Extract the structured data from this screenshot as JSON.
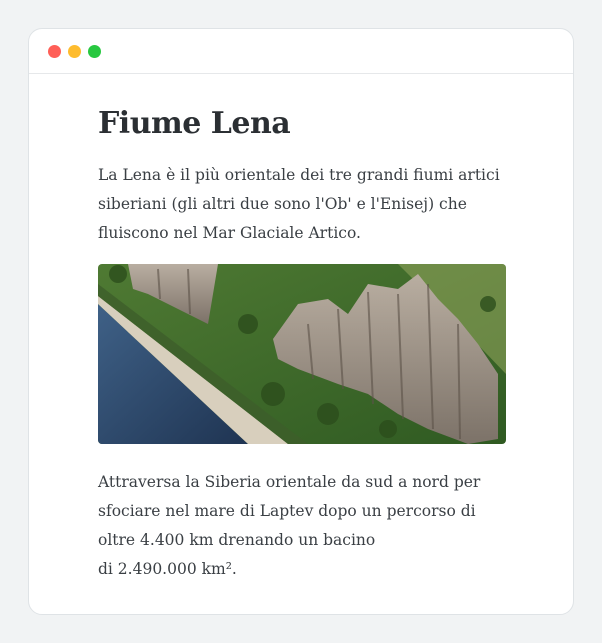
{
  "window": {
    "controls": [
      "close",
      "minimize",
      "maximize"
    ]
  },
  "article": {
    "title": "Fiume Lena",
    "intro": "La Lena è il più orientale dei tre grandi fiumi artici siberiani (gli altri due sono l'Ob' e l'Enisej) che fluiscono nel Mar Glaciale Artico.",
    "image": {
      "subject": "Lena Pillars cliffs along the Lena river"
    },
    "body_line1": "Attraversa la Siberia orientale da sud a nord per",
    "body_line2": "sfociare nel mare di Laptev dopo un percorso di",
    "body_line3": "oltre 4.400 km drenando un bacino",
    "body_line4": "di 2.490.000 km²."
  }
}
